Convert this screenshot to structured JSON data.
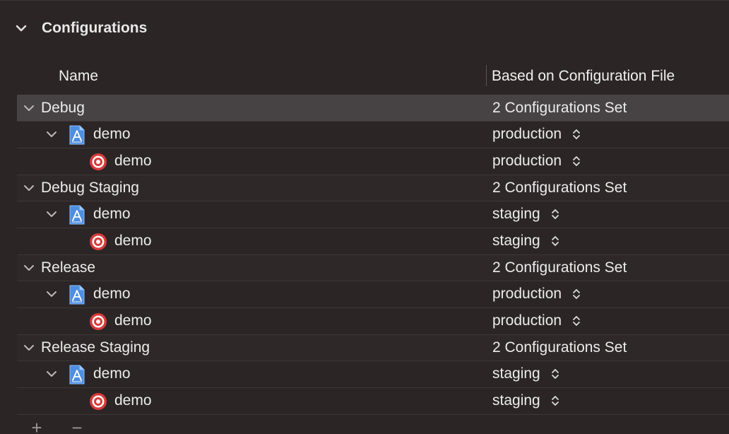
{
  "section": {
    "title": "Configurations"
  },
  "columns": {
    "name": "Name",
    "file": "Based on Configuration File"
  },
  "rows": [
    {
      "level": 0,
      "kind": "group",
      "label": "Debug",
      "value": "2 Configurations Set",
      "selected": true
    },
    {
      "level": 1,
      "kind": "project",
      "label": "demo",
      "value": "production"
    },
    {
      "level": 2,
      "kind": "target",
      "label": "demo",
      "value": "production"
    },
    {
      "level": 0,
      "kind": "group",
      "label": "Debug Staging",
      "value": "2 Configurations Set",
      "selected": false
    },
    {
      "level": 1,
      "kind": "project",
      "label": "demo",
      "value": "staging"
    },
    {
      "level": 2,
      "kind": "target",
      "label": "demo",
      "value": "staging"
    },
    {
      "level": 0,
      "kind": "group",
      "label": "Release",
      "value": "2 Configurations Set",
      "selected": false
    },
    {
      "level": 1,
      "kind": "project",
      "label": "demo",
      "value": "production"
    },
    {
      "level": 2,
      "kind": "target",
      "label": "demo",
      "value": "production"
    },
    {
      "level": 0,
      "kind": "group",
      "label": "Release Staging",
      "value": "2 Configurations Set",
      "selected": false
    },
    {
      "level": 1,
      "kind": "project",
      "label": "demo",
      "value": "staging"
    },
    {
      "level": 2,
      "kind": "target",
      "label": "demo",
      "value": "staging"
    }
  ],
  "toolbar": {
    "add_label": "+",
    "remove_label": "−"
  },
  "icons": {
    "section_toggle": "chevron-down-icon",
    "row_toggle": "chevron-down-icon",
    "project": "xcode-project-icon",
    "target": "app-target-icon",
    "popup": "up-down-arrows-icon"
  },
  "colors": {
    "background": "#2b2526",
    "selected_row": "#474344",
    "target_red": "#d93a3a",
    "project_blue": "#5aa0f0"
  }
}
